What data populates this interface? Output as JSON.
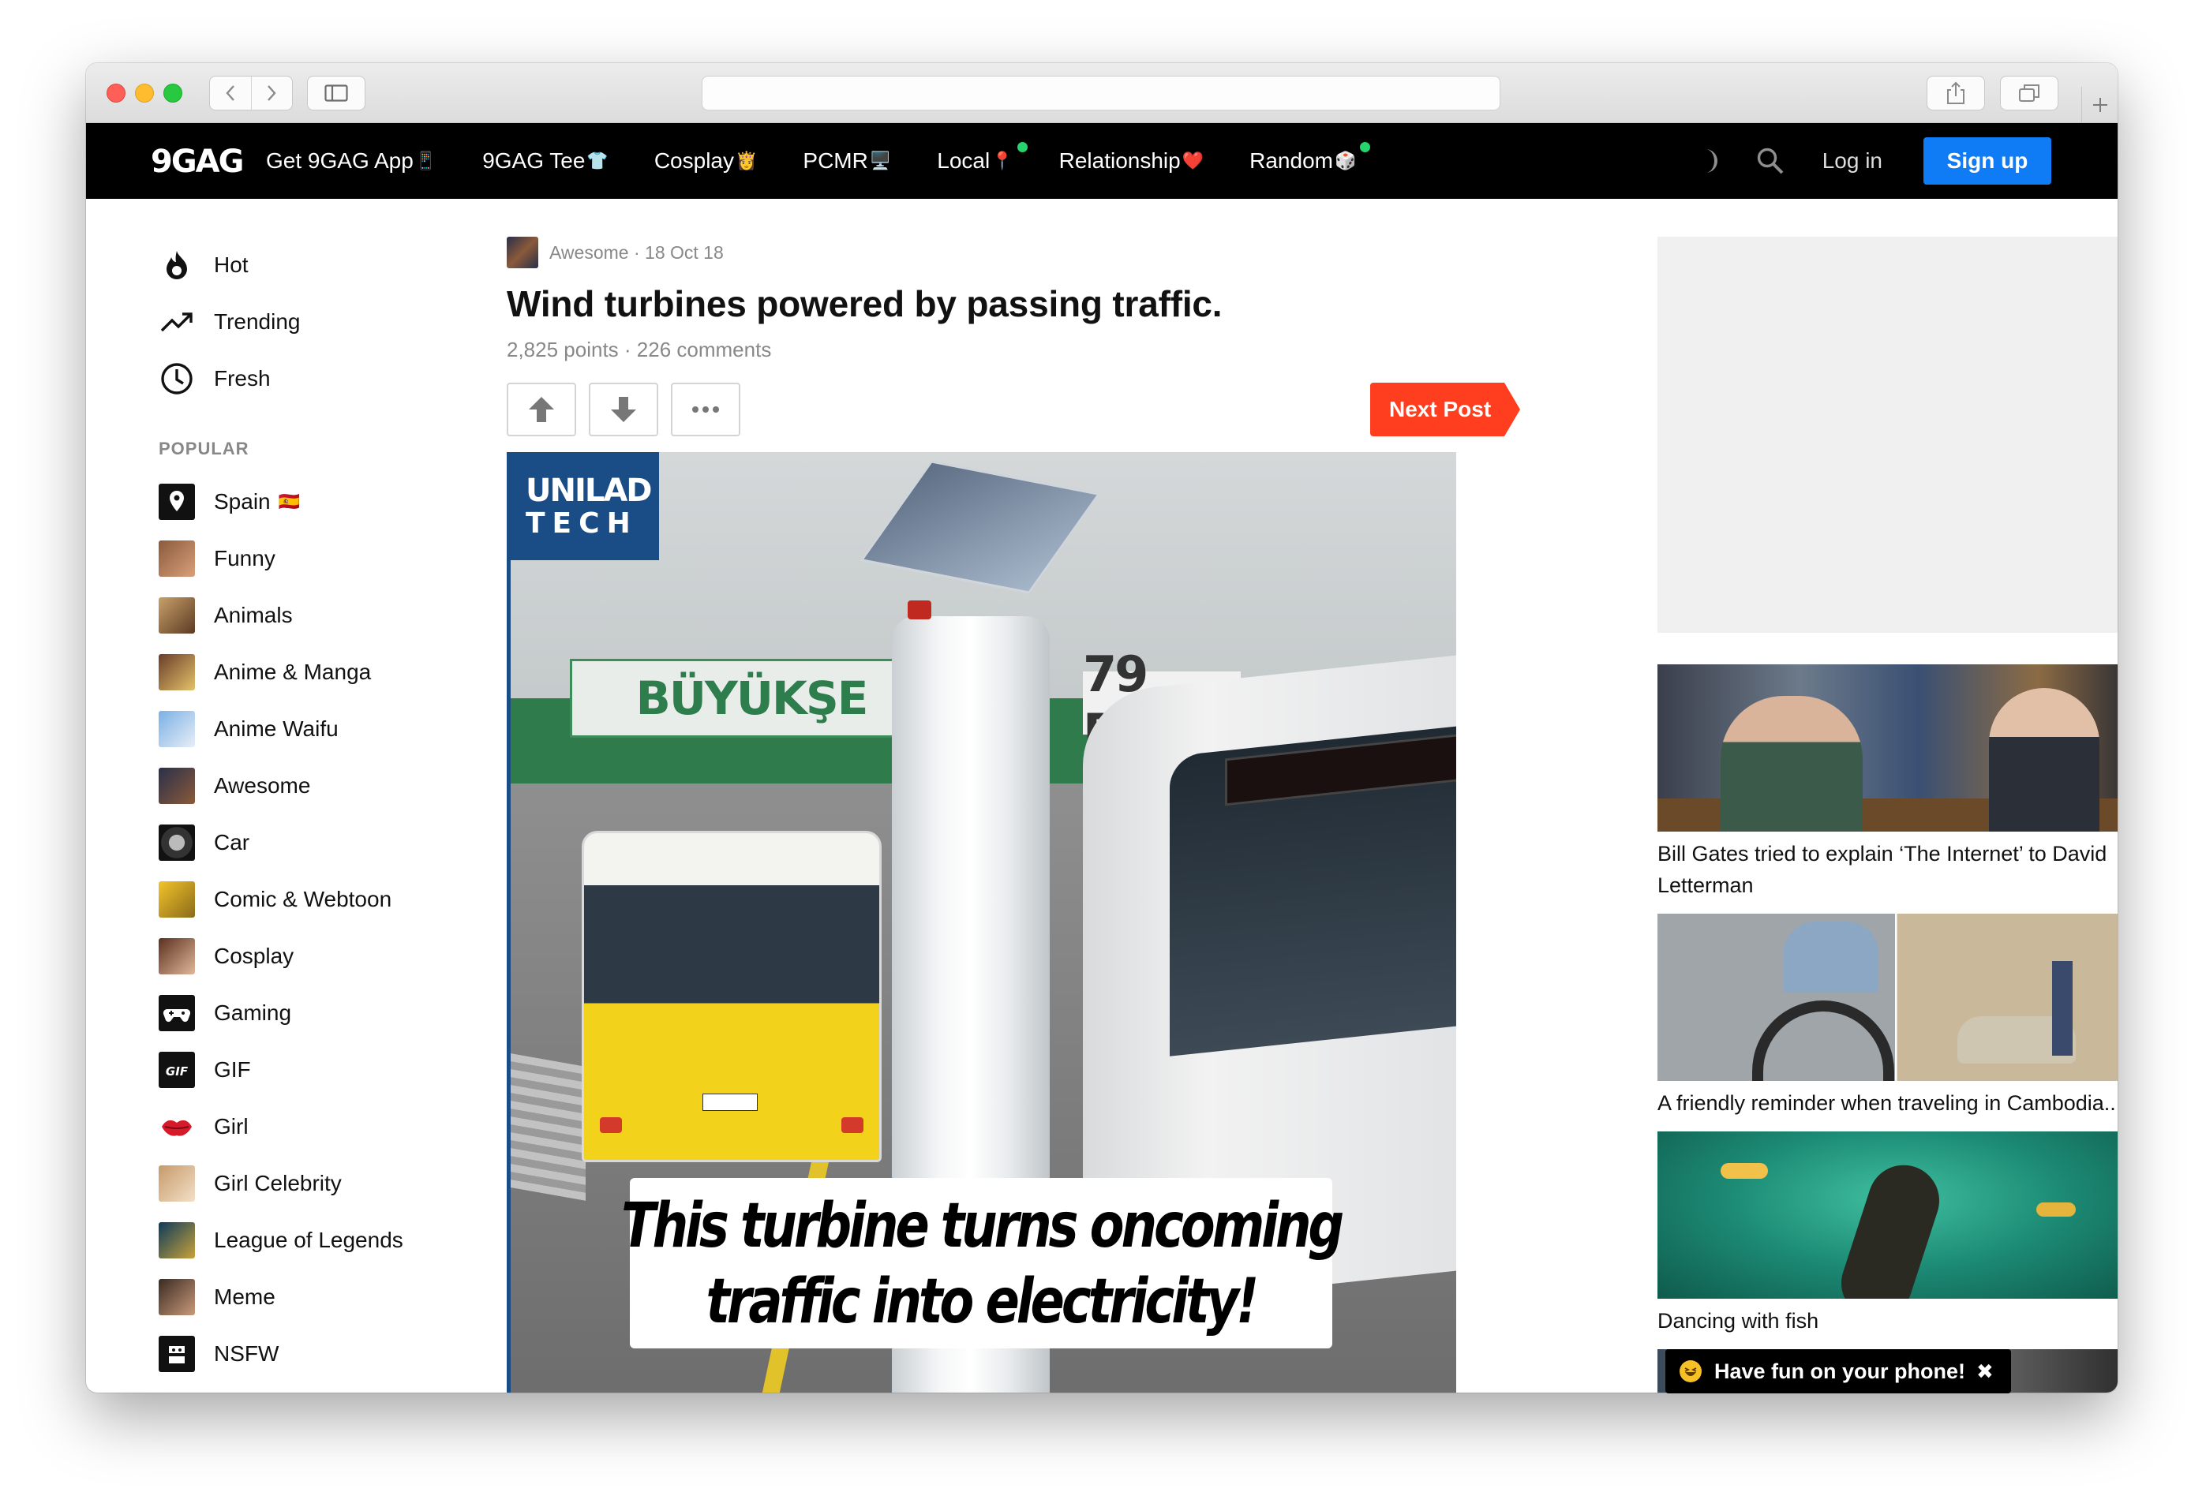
{
  "browser": {
    "address": ""
  },
  "header": {
    "logo": "9GAG",
    "nav": [
      {
        "label": "Get 9GAG App",
        "emoji": "📱",
        "dot": false
      },
      {
        "label": "9GAG Tee",
        "emoji": "👕",
        "dot": false
      },
      {
        "label": "Cosplay",
        "emoji": "👸",
        "dot": false
      },
      {
        "label": "PCMR",
        "emoji": "🖥️",
        "dot": false
      },
      {
        "label": "Local",
        "emoji": "📍",
        "dot": true
      },
      {
        "label": "Relationship",
        "emoji": "❤️",
        "dot": false
      },
      {
        "label": "Random",
        "emoji": "🎲",
        "dot": true
      }
    ],
    "login": "Log in",
    "signup": "Sign up",
    "accent": "#0f7cf5",
    "dot_color": "#26d46e"
  },
  "sidebar": {
    "main": [
      {
        "label": "Hot",
        "icon": "flame-icon"
      },
      {
        "label": "Trending",
        "icon": "trending-icon"
      },
      {
        "label": "Fresh",
        "icon": "clock-icon"
      }
    ],
    "popular_heading": "POPULAR",
    "popular": [
      {
        "label": "Spain",
        "flag": "🇪🇸",
        "icon": "map-pin-icon"
      },
      {
        "label": "Funny",
        "icon": "funny-avatar"
      },
      {
        "label": "Animals",
        "icon": "animals-avatar"
      },
      {
        "label": "Anime & Manga",
        "icon": "anime-avatar"
      },
      {
        "label": "Anime Waifu",
        "icon": "waifu-avatar"
      },
      {
        "label": "Awesome",
        "icon": "awesome-avatar"
      },
      {
        "label": "Car",
        "icon": "car-avatar"
      },
      {
        "label": "Comic & Webtoon",
        "icon": "comic-avatar"
      },
      {
        "label": "Cosplay",
        "icon": "cosplay-avatar"
      },
      {
        "label": "Gaming",
        "icon": "gamepad-icon"
      },
      {
        "label": "GIF",
        "icon": "gif-icon"
      },
      {
        "label": "Girl",
        "icon": "lips-icon"
      },
      {
        "label": "Girl Celebrity",
        "icon": "celebrity-avatar"
      },
      {
        "label": "League of Legends",
        "icon": "lol-avatar"
      },
      {
        "label": "Meme",
        "icon": "meme-avatar"
      },
      {
        "label": "NSFW",
        "icon": "nsfw-icon"
      }
    ]
  },
  "post": {
    "section": "Awesome",
    "date": "18 Oct 18",
    "title": "Wind turbines powered by passing traffic.",
    "points": "2,825 points",
    "comments": "226 comments",
    "next_label": "Next Post",
    "next_color": "#ff3e1f",
    "media": {
      "badge_line1": "UNILAD",
      "badge_line2": "TECH",
      "sign1": "BÜYÜKŞE",
      "sign2": "79 BİN",
      "caption_line1": "This turbine turns oncoming",
      "caption_line2": "traffic into electricity!"
    }
  },
  "related": [
    {
      "title": "Bill Gates tried to explain ‘The Internet’ to David Letterman"
    },
    {
      "title": "A friendly reminder when traveling in Cambodia..."
    },
    {
      "title": "Dancing with fish"
    }
  ],
  "toast": {
    "text": "Have fun on your phone!",
    "close": "✖"
  }
}
